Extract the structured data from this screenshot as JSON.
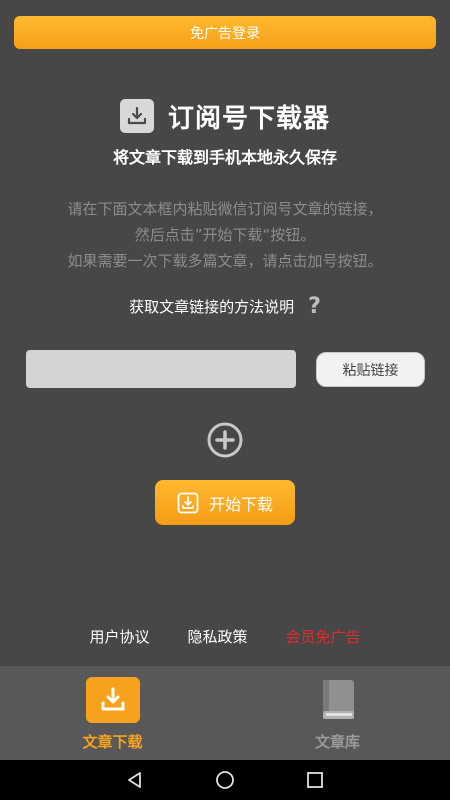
{
  "banner": {
    "label": "免广告登录"
  },
  "header": {
    "title": "订阅号下载器",
    "subtitle": "将文章下载到手机本地永久保存"
  },
  "instructions": {
    "line1": "请在下面文本框内粘贴微信订阅号文章的链接，",
    "line2": "然后点击”开始下载“按钮。",
    "line3": "如果需要一次下载多篇文章，请点击加号按钮。"
  },
  "help": {
    "label": "获取文章链接的方法说明",
    "icon": "?"
  },
  "link_input": {
    "value": "",
    "placeholder": ""
  },
  "paste_button": {
    "label": "粘贴链接"
  },
  "start_button": {
    "label": "开始下载"
  },
  "footer": {
    "user_agreement": "用户协议",
    "privacy_policy": "隐私政策",
    "vip": "会员免广告"
  },
  "tabs": [
    {
      "label": "文章下载",
      "icon": "download-icon",
      "active": true
    },
    {
      "label": "文章库",
      "icon": "book-icon",
      "active": false
    }
  ],
  "colors": {
    "accent": "#f7a21d",
    "background": "#474747",
    "vip_red": "#e42a2a"
  }
}
